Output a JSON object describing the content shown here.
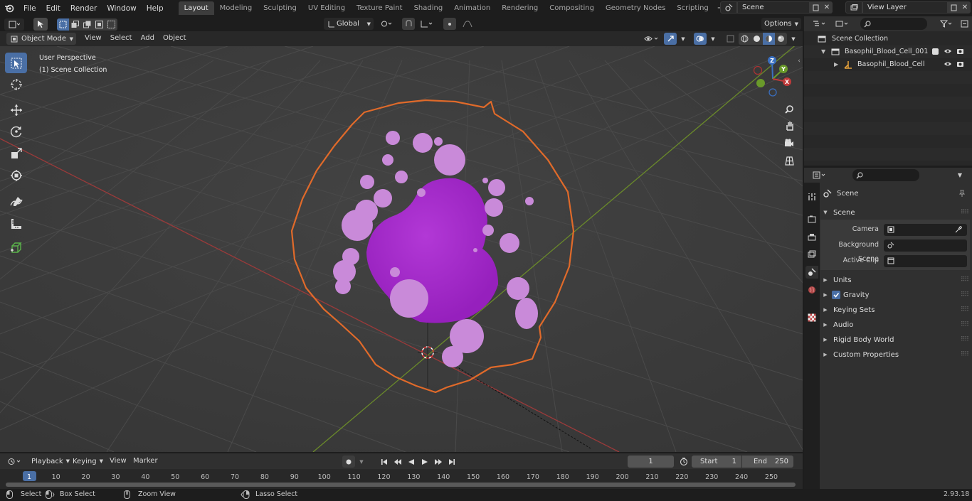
{
  "menu": {
    "file": "File",
    "edit": "Edit",
    "render": "Render",
    "window": "Window",
    "help": "Help"
  },
  "workspaces": [
    "Layout",
    "Modeling",
    "Sculpting",
    "UV Editing",
    "Texture Paint",
    "Shading",
    "Animation",
    "Rendering",
    "Compositing",
    "Geometry Nodes",
    "Scripting"
  ],
  "active_workspace": "Layout",
  "scene_name": "Scene",
  "view_layer": "View Layer",
  "viewport": {
    "mode": "Object Mode",
    "menus": [
      "View",
      "Select",
      "Add",
      "Object"
    ],
    "transform_orientation": "Global",
    "options_label": "Options",
    "overlay_line1": "User Perspective",
    "overlay_line2": "(1) Scene Collection"
  },
  "outliner": {
    "scene_collection": "Scene Collection",
    "items": [
      {
        "label": "Basophil_Blood_Cell_001"
      },
      {
        "label": "Basophil_Blood_Cell"
      }
    ]
  },
  "properties": {
    "breadcrumb": "Scene",
    "section_title": "Scene",
    "camera_label": "Camera",
    "bg_scene_label": "Background Scene",
    "active_clip_label": "Active Clip",
    "panels": [
      "Units",
      "Gravity",
      "Keying Sets",
      "Audio",
      "Rigid Body World",
      "Custom Properties"
    ]
  },
  "timeline": {
    "menus": [
      "Playback",
      "Keying",
      "View",
      "Marker"
    ],
    "current_frame": "1",
    "start_label": "Start",
    "start_value": "1",
    "end_label": "End",
    "end_value": "250",
    "ticks": [
      "1",
      "10",
      "20",
      "30",
      "40",
      "50",
      "60",
      "70",
      "80",
      "90",
      "100",
      "110",
      "120",
      "130",
      "140",
      "150",
      "160",
      "170",
      "180",
      "190",
      "200",
      "210",
      "220",
      "230",
      "240",
      "250"
    ]
  },
  "statusbar": {
    "select": "Select",
    "box_select": "Box Select",
    "zoom_view": "Zoom View",
    "lasso_select": "Lasso Select",
    "version": "2.93.18"
  },
  "colors": {
    "accent": "#4a6fa5",
    "object_cell": "#a22ac9",
    "granule": "#c98ad9",
    "selection_outline": "#e06a2a"
  }
}
